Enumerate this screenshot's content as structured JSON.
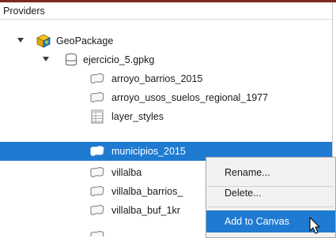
{
  "panel": {
    "title": "Providers"
  },
  "tree": [
    {
      "id": "geopackage",
      "label": "GeoPackage",
      "icon": "geopackage-icon",
      "expanded": true
    },
    {
      "id": "ejercicio",
      "label": "ejercicio_5.gpkg",
      "icon": "database-icon",
      "expanded": true
    },
    {
      "id": "arroyo-barrios",
      "label": "arroyo_barrios_2015",
      "icon": "polygon-layer-icon"
    },
    {
      "id": "arroyo-usos",
      "label": "arroyo_usos_suelos_regional_1977",
      "icon": "polygon-layer-icon"
    },
    {
      "id": "layer-styles",
      "label": "layer_styles",
      "icon": "table-icon"
    },
    {
      "id": "municipios",
      "label": "municipios_2015",
      "icon": "polygon-layer-icon",
      "selected": true
    },
    {
      "id": "villalba",
      "label": "villalba",
      "icon": "polygon-layer-icon"
    },
    {
      "id": "villalba-barrios",
      "label": "villalba_barrios_",
      "icon": "polygon-layer-icon"
    },
    {
      "id": "villalba-buf",
      "label": "villalba_buf_1kr",
      "icon": "polygon-layer-icon"
    }
  ],
  "context_menu": {
    "items": [
      {
        "label": "Rename..."
      },
      {
        "label": "Delete..."
      },
      {
        "label": "Add to Canvas",
        "highlighted": true
      }
    ]
  },
  "colors": {
    "selection": "#1f7bd1",
    "menu_bg": "#f2f2f2",
    "top_strip": "#7a2a1f"
  }
}
